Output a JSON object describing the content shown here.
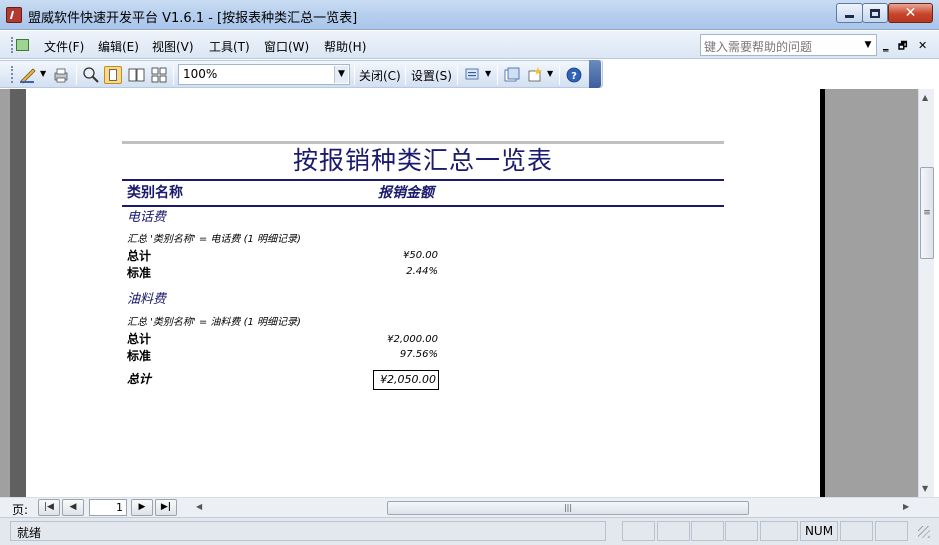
{
  "window": {
    "title": "盟威软件快速开发平台 V1.6.1 - [按报表种类汇总一览表]",
    "close_glyph": "✕"
  },
  "menu": {
    "items": [
      "文件(F)",
      "编辑(E)",
      "视图(V)",
      "工具(T)",
      "窗口(W)",
      "帮助(H)"
    ],
    "help_placeholder": "键入需要帮助的问题",
    "mdi_min": "‗",
    "mdi_restore": "🗗",
    "mdi_close": "✕"
  },
  "toolbar": {
    "zoom": "100%",
    "close_label": "关闭(C)",
    "setup_label": "设置(S)"
  },
  "report": {
    "title": "按报销种类汇总一览表",
    "header_category": "类别名称",
    "header_amount": "报销金额",
    "groups": [
      {
        "name": "电话费",
        "summary": "汇总 '类别名称' =  电话费 (1 明细记录)",
        "total_label": "总计",
        "total": "¥50.00",
        "std_label": "标准",
        "std": "2.44%"
      },
      {
        "name": "油料费",
        "summary": "汇总 '类别名称' =  油料费 (1 明细记录)",
        "total_label": "总计",
        "total": "¥2,000.00",
        "std_label": "标准",
        "std": "97.56%"
      }
    ],
    "grand_total_label": "总计",
    "grand_total": "¥2,050.00"
  },
  "nav": {
    "page_label": "页:",
    "page_number": "1"
  },
  "status": {
    "text": "就绪",
    "num": "NUM"
  }
}
